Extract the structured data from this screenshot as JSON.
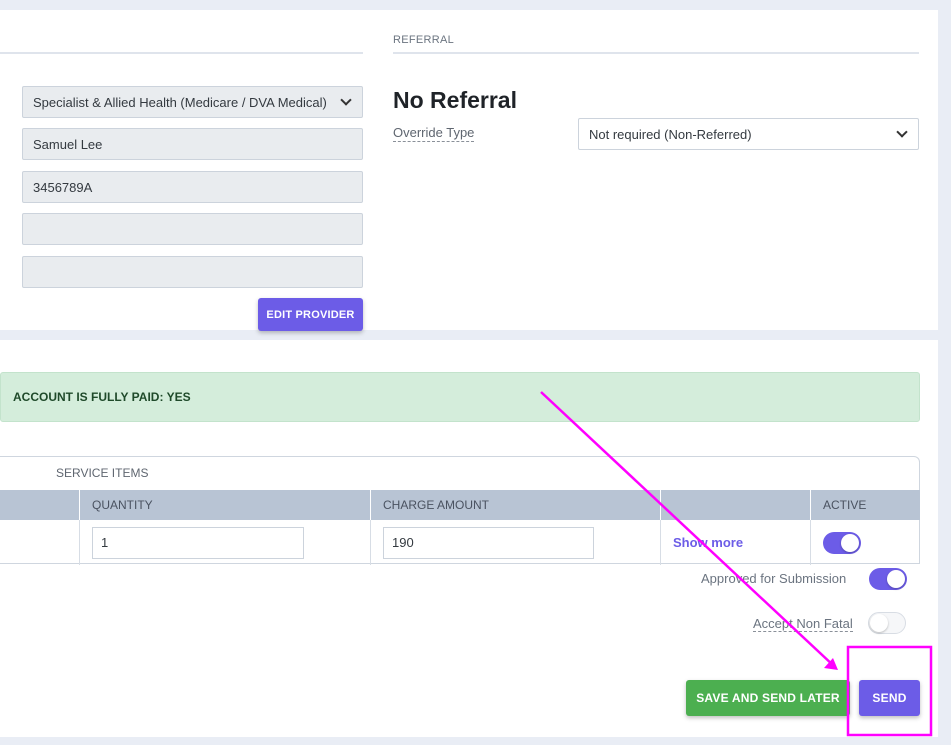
{
  "provider": {
    "service_type": "Specialist & Allied Health (Medicare / DVA Medical)",
    "provider_name": "Samuel Lee",
    "provider_number": "3456789A",
    "field_4": "",
    "field_5": "",
    "edit_button": "EDIT PROVIDER"
  },
  "referral": {
    "section_label": "REFERRAL",
    "title": "No Referral",
    "override_label": "Override Type",
    "override_value": "Not required (Non-Referred)"
  },
  "account": {
    "paid_status": "ACCOUNT IS FULLY PAID: YES"
  },
  "service_items": {
    "tab_label": "SERVICE ITEMS",
    "columns": [
      "QUANTITY",
      "CHARGE AMOUNT",
      "",
      "ACTIVE"
    ],
    "row": {
      "quantity": "1",
      "charge_amount": "190",
      "show_more": "Show more",
      "active": true
    }
  },
  "options": {
    "approved_label": "Approved for Submission",
    "approved": true,
    "accept_label": "Accept Non Fatal",
    "accept": false
  },
  "actions": {
    "save_later": "SAVE AND SEND LATER",
    "send": "SEND"
  },
  "colors": {
    "primary": "#6c5ce7",
    "success": "#4caf50",
    "annotation": "#ff00ff"
  }
}
